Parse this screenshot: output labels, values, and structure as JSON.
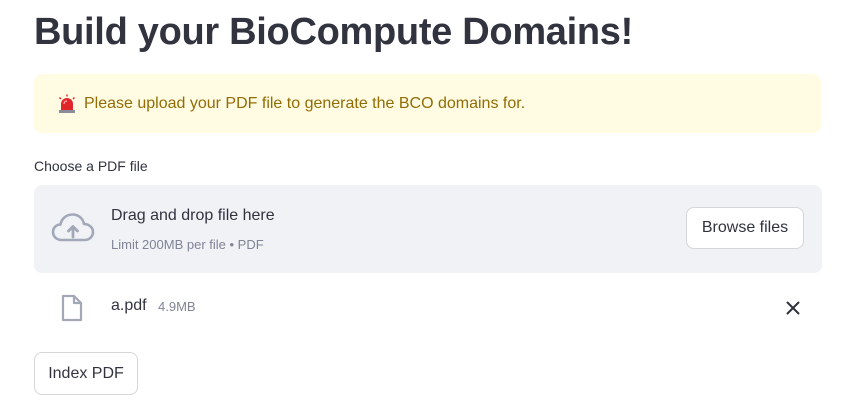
{
  "header": {
    "title": "Build your BioCompute Domains!"
  },
  "alert": {
    "icon": "rotating-light-icon",
    "message": "Please upload your PDF file to generate the BCO domains for.",
    "background_color": "#fffce3",
    "text_color": "#926c05"
  },
  "uploader": {
    "label": "Choose a PDF file",
    "drop_title": "Drag and drop file here",
    "drop_subtitle": "Limit 200MB per file • PDF",
    "browse_label": "Browse files",
    "icon": "cloud-upload-icon"
  },
  "uploaded_file": {
    "name": "a.pdf",
    "size": "4.9MB",
    "icon": "file-icon",
    "remove_icon": "close-icon"
  },
  "actions": {
    "index_label": "Index PDF"
  }
}
